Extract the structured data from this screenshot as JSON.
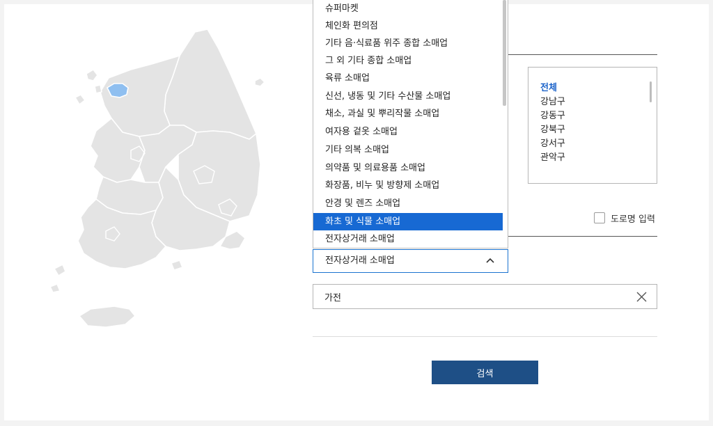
{
  "district_list": {
    "items": [
      "전체",
      "강남구",
      "강동구",
      "강북구",
      "강서구",
      "관악구"
    ],
    "active_index": 0
  },
  "road_name_checkbox": {
    "label": "도로명 입력",
    "checked": false
  },
  "industry_dropdown": {
    "options": [
      "슈퍼마켓",
      "체인화 편의점",
      "기타 음·식료품 위주 종합 소매업",
      "그 외 기타 종합 소매업",
      "육류 소매업",
      "신선, 냉동 및 기타 수산물 소매업",
      "채소, 과실 및 뿌리작물 소매업",
      "여자용 겉옷 소매업",
      "기타 의복 소매업",
      "의약품 및 의료용품 소매업",
      "화장품, 비누 및 방향제 소매업",
      "안경 및 렌즈 소매업",
      "화초 및 식물 소매업",
      "전자상거래 소매업"
    ],
    "highlighted_index": 12,
    "selected_value": "전자상거래 소매업"
  },
  "keyword": {
    "value": "가전"
  },
  "search_button": {
    "label": "검색"
  },
  "colors": {
    "accent": "#1769d3",
    "button": "#1e4f86",
    "highlight_region": "#8fbff0",
    "map_fill": "#e4e4e4"
  }
}
